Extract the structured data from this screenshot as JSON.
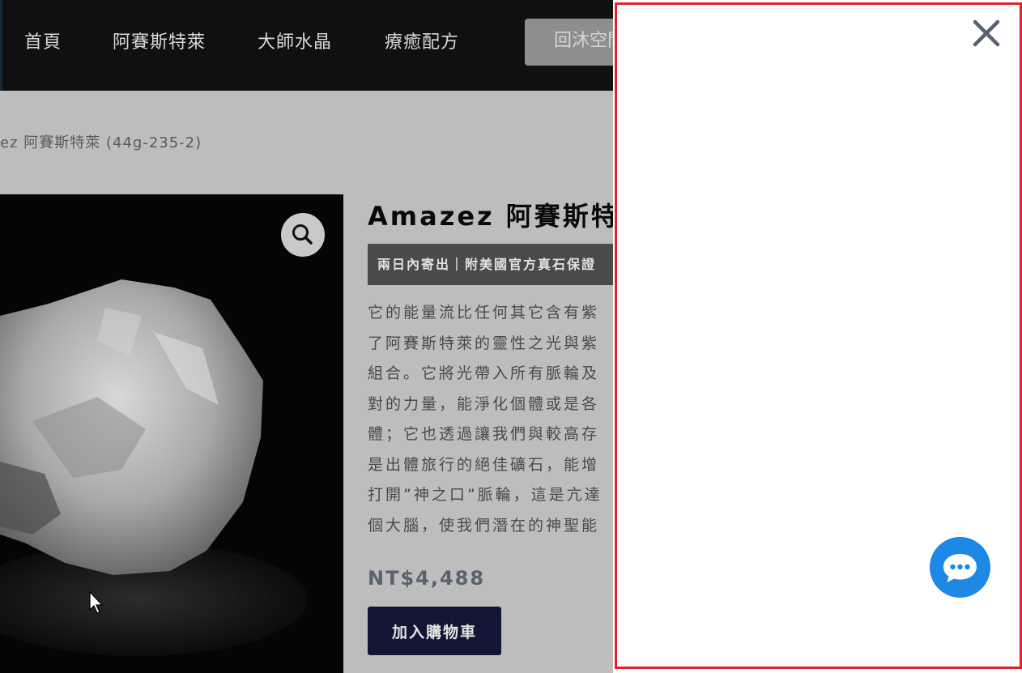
{
  "nav": {
    "items": [
      "首頁",
      "阿賽斯特萊",
      "大師水晶",
      "療癒配方"
    ],
    "button_label": "回沐空間"
  },
  "breadcrumb": "ez 阿賽斯特萊 (44g-235-2)",
  "product": {
    "title": "Amazez 阿賽斯特萊",
    "badge": "兩日內寄出｜附美國官方真石保證",
    "description_lines": [
      "它的能量流比任何其它含有紫",
      "了阿賽斯特萊的靈性之光與紫",
      "組合。它將光帶入所有脈輪及",
      "對的力量，能淨化個體或是各",
      "體；它也透過讓我們與較高存",
      "是出體旅行的絕佳礦石，能增",
      "打開”神之口”脈輪，這是亢達",
      "個大腦，使我們潛在的神聖能"
    ],
    "price": "NT$4,488",
    "add_to_cart_label": "加入購物車"
  },
  "icons": {
    "zoom": "magnifier-icon",
    "close": "close-icon",
    "chat": "chat-bubble-icon",
    "cursor": "mouse-pointer-icon"
  },
  "colors": {
    "nav_bg": "#0f1011",
    "cart_button": "#121634",
    "drawer_outline": "#e5222b",
    "chat_button": "#1e88e5"
  }
}
